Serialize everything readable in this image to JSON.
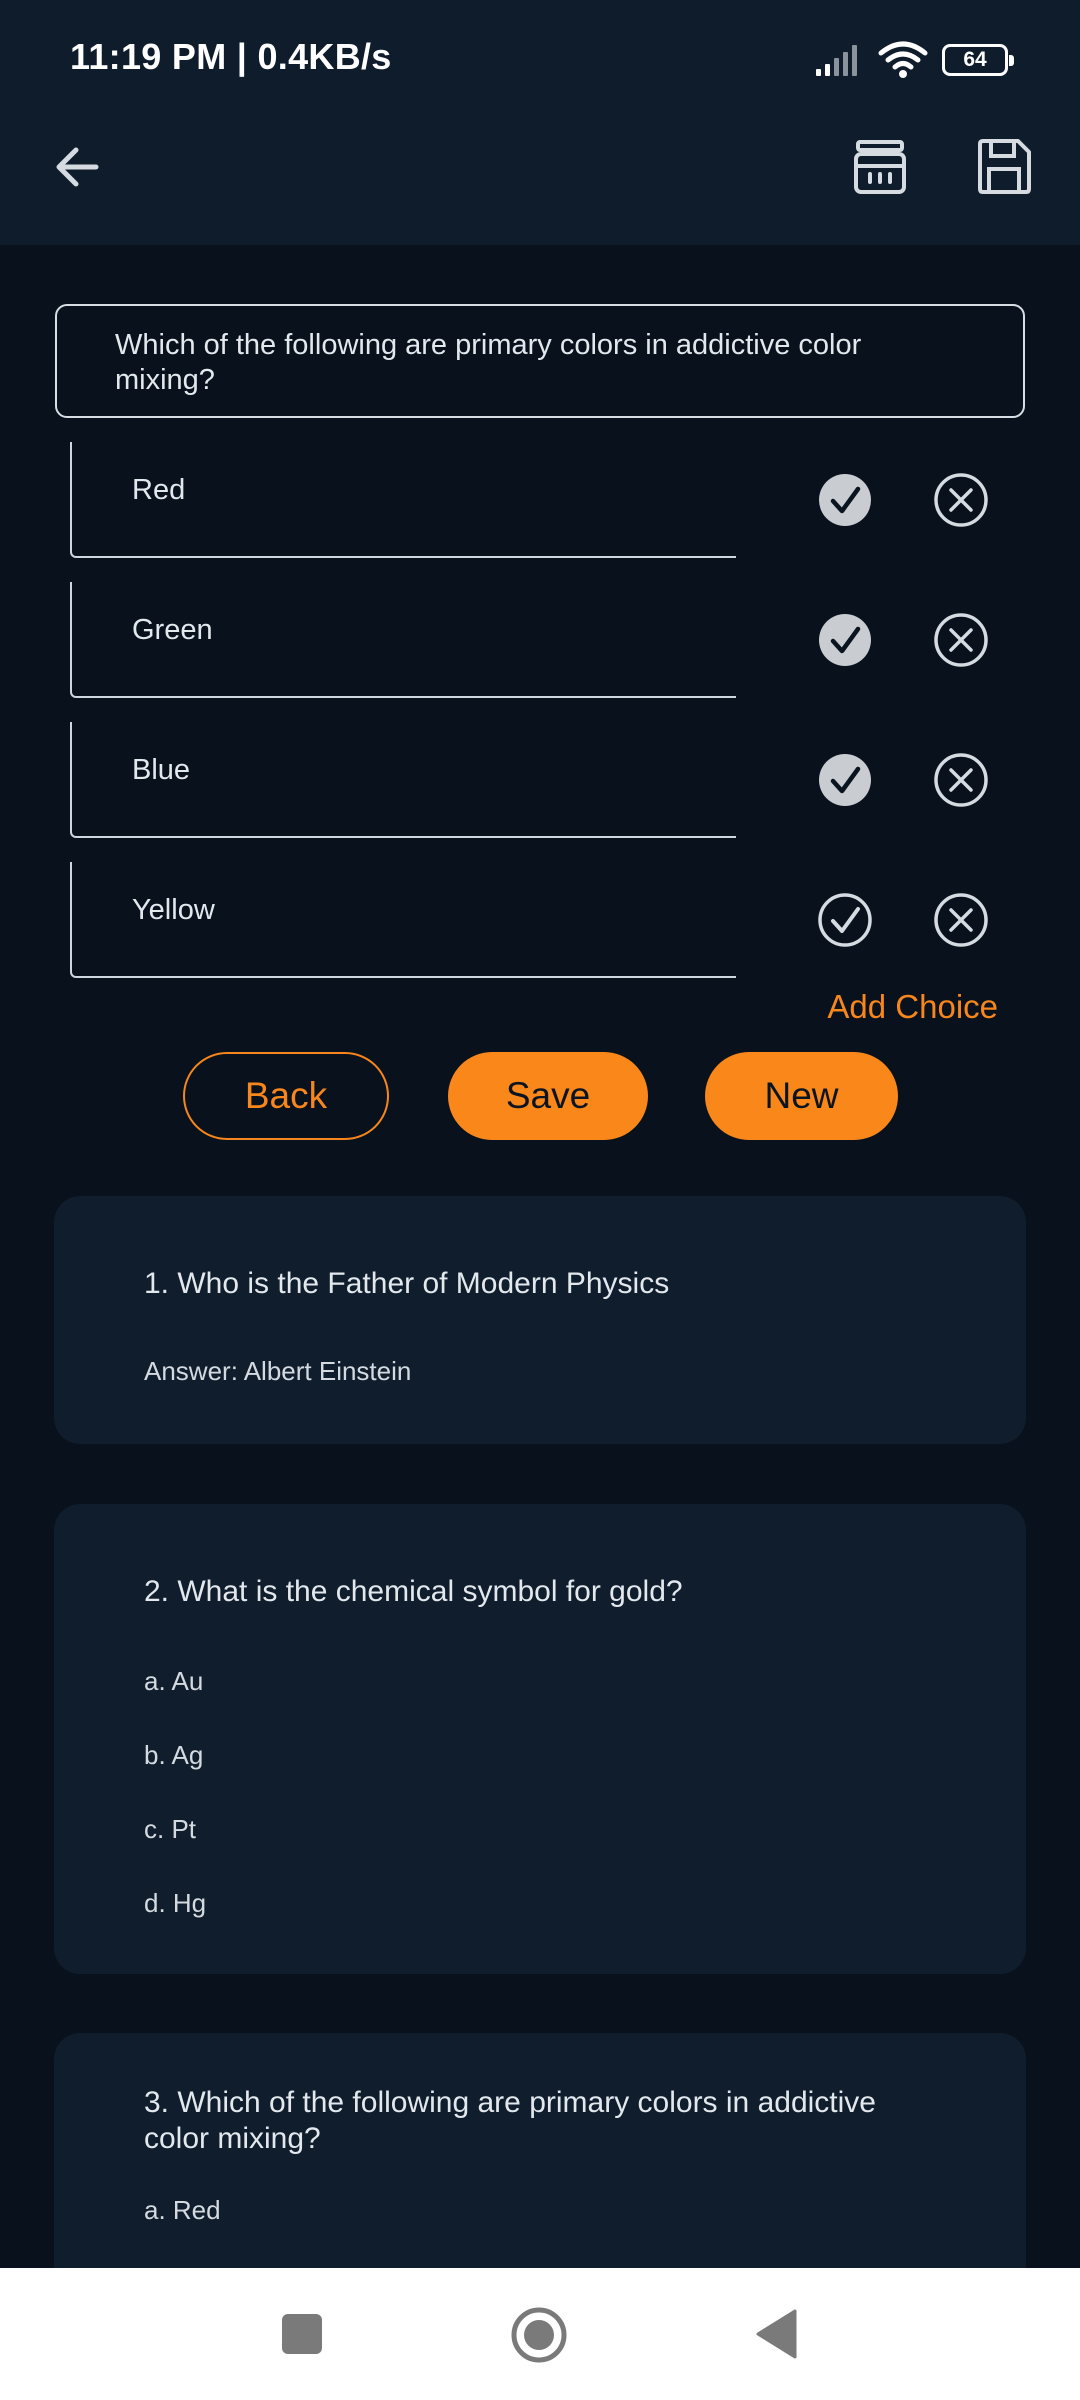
{
  "status_bar": {
    "time_speed": "11:19 PM | 0.4KB/s",
    "signal_icon": "cellular-signal-icon",
    "wifi_icon": "wifi-icon",
    "battery_level": "64"
  },
  "app_bar": {
    "back_icon": "arrow-left-icon",
    "archive_icon": "archive-box-icon",
    "save_icon": "floppy-disk-icon"
  },
  "editor": {
    "question": "Which of the following are primary colors in addictive color mixing?",
    "choices": [
      {
        "text": "Red",
        "correct": true
      },
      {
        "text": "Green",
        "correct": true
      },
      {
        "text": "Blue",
        "correct": true
      },
      {
        "text": "Yellow",
        "correct": false
      }
    ],
    "add_choice_label": "Add Choice",
    "back_label": "Back",
    "save_label": "Save",
    "new_label": "New"
  },
  "saved_questions": [
    {
      "question": "1. Who is the Father of Modern Physics",
      "answer": "Answer: Albert Einstein"
    },
    {
      "question": "2. What is the chemical symbol for gold?",
      "options": [
        "a. Au",
        "b. Ag",
        "c. Pt",
        "d. Hg"
      ]
    },
    {
      "question": "3. Which of the following are primary colors in addictive color mixing?",
      "options": [
        "a. Red"
      ]
    }
  ],
  "colors": {
    "accent": "#f9871a",
    "background": "#08111c",
    "card": "#0f1d2d",
    "top_bar": "#0e1c2b"
  },
  "nav_bar": {
    "recents_icon": "square-recents-icon",
    "home_icon": "circle-home-icon",
    "back_icon": "triangle-back-icon"
  }
}
